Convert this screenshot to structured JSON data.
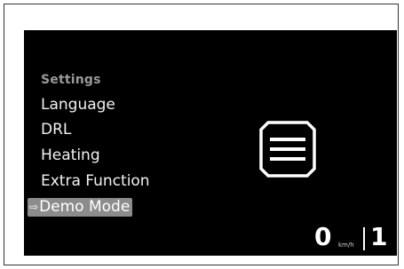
{
  "menu": {
    "title": "Settings",
    "items": [
      {
        "label": "Language"
      },
      {
        "label": "DRL"
      },
      {
        "label": "Heating"
      },
      {
        "label": "Extra Function"
      }
    ],
    "selected": {
      "label": "Demo Mode",
      "marker": "⇨"
    }
  },
  "icon": {
    "name": "menu-icon"
  },
  "status": {
    "speed": "0",
    "speed_unit": "km/h",
    "gear": "1"
  },
  "colors": {
    "screen_bg": "#000000",
    "text": "#f2f2f2",
    "title": "#9a9a9a",
    "highlight": "#8c8c8c"
  }
}
